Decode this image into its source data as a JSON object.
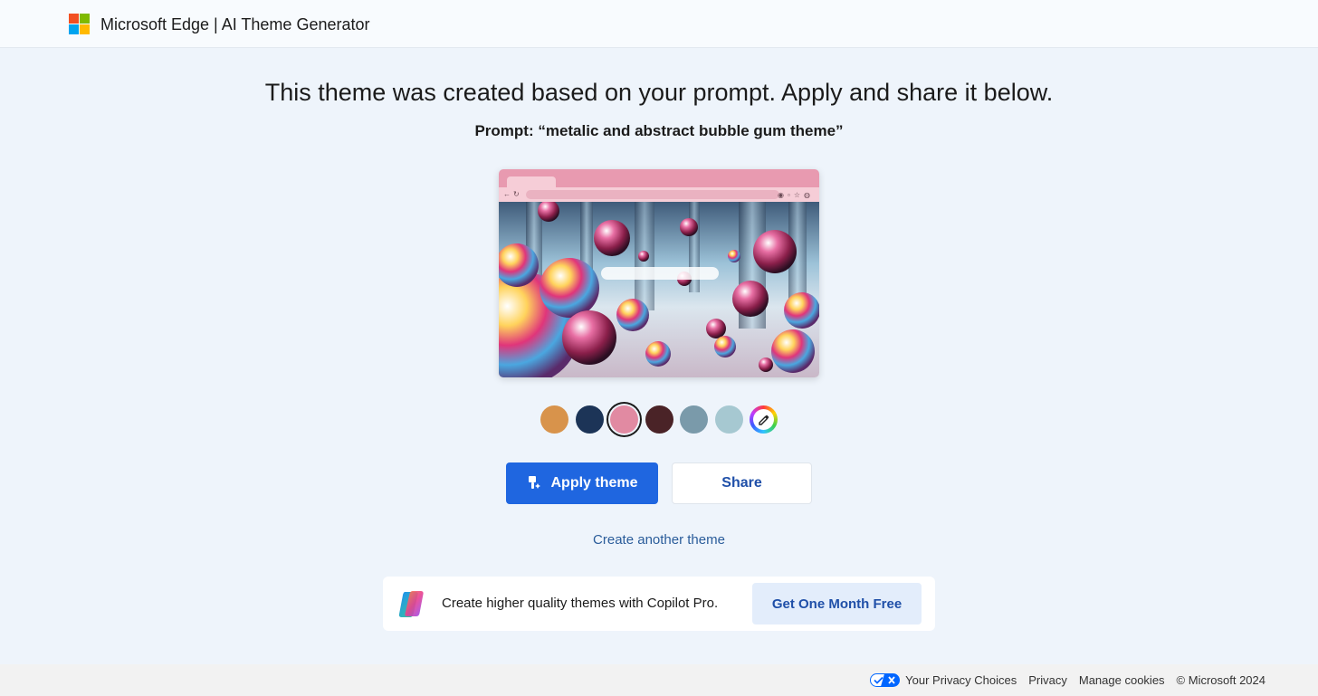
{
  "header": {
    "brand": "Microsoft Edge | AI Theme Generator",
    "logo_colors": [
      "#f25022",
      "#7fba00",
      "#00a4ef",
      "#ffb900"
    ]
  },
  "main": {
    "headline": "This theme was created based on your prompt. Apply and share it below.",
    "prompt": "Prompt: “metalic and abstract bubble gum theme”",
    "swatches": [
      {
        "name": "orange",
        "color": "#d8934b"
      },
      {
        "name": "navy",
        "color": "#1c3457"
      },
      {
        "name": "pink",
        "color": "#e18aa2",
        "selected": true
      },
      {
        "name": "maroon",
        "color": "#4a2327"
      },
      {
        "name": "slate",
        "color": "#7a9aaa"
      },
      {
        "name": "light-blue",
        "color": "#a6c8d1"
      },
      {
        "name": "custom-color-picker",
        "icon": "eyedropper-icon"
      }
    ],
    "apply_label": "Apply theme",
    "share_label": "Share",
    "create_another": "Create another theme"
  },
  "promo": {
    "text": "Create higher quality themes with Copilot Pro.",
    "button": "Get One Month Free",
    "icon": "copilot-icon"
  },
  "footer": {
    "privacy_choices": "Your Privacy Choices",
    "privacy": "Privacy",
    "manage_cookies": "Manage cookies",
    "copyright": "© Microsoft 2024"
  },
  "colors": {
    "accent": "#1f66e0",
    "background": "#eef4fb"
  }
}
